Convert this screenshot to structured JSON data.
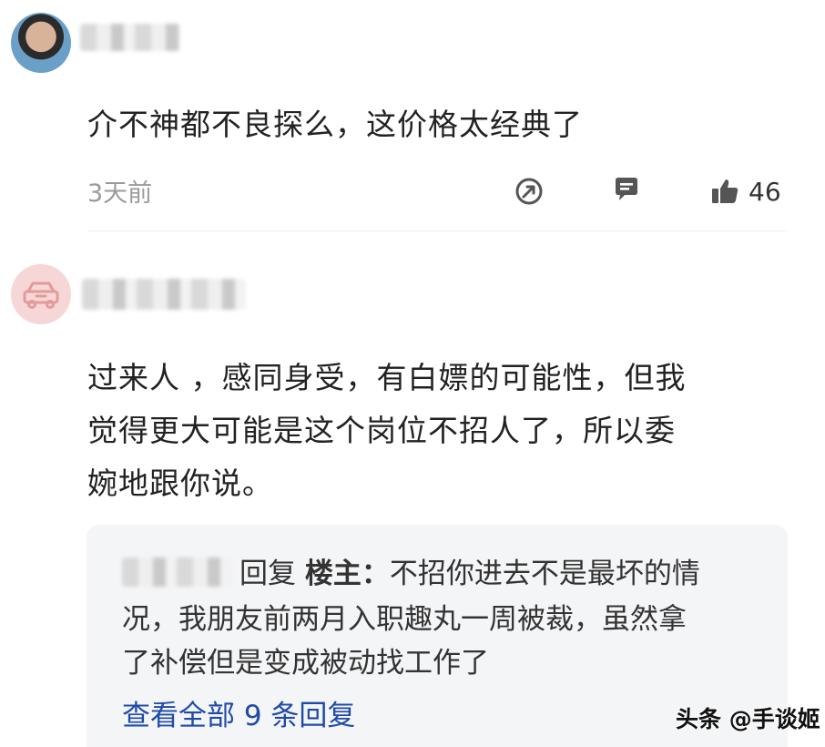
{
  "comments": [
    {
      "text": "介不神都不良探么，这价格太经典了",
      "time": "3天前",
      "likes": "46"
    },
    {
      "text_line1": "过来人 ，感同身受，有白嫖的可能性，但我",
      "text_line2": "觉得更大可能是这个岗位不招人了，所以委",
      "text_line3": "婉地跟你说。"
    }
  ],
  "reply": {
    "action": "回复",
    "target": "楼主：",
    "line1": "不招你进去不是最坏的情",
    "line2": "况，我朋友前两月入职趣丸一周被裁，虽然拿",
    "line3": "了补偿但是变成被动找工作了",
    "view_all": "查看全部 9 条回复"
  },
  "watermark": "头条 @手谈姬",
  "icons": {
    "share": "share-icon",
    "comment": "comment-icon",
    "like": "thumbs-up-icon",
    "avatar2": "taxi-icon"
  },
  "colors": {
    "link": "#1f4aa8",
    "meta": "#9a9a9a",
    "reply_bg": "#f4f5f7"
  }
}
